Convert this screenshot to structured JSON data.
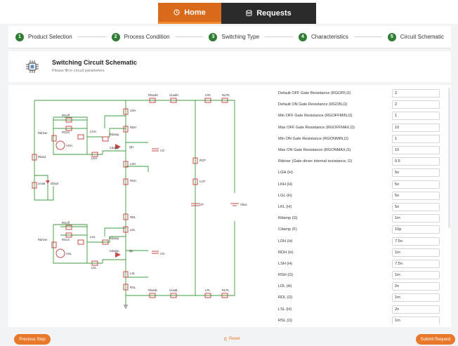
{
  "nav": {
    "home_label": "Home",
    "requests_label": "Requests",
    "home_icon": "clock-icon",
    "requests_icon": "database-icon"
  },
  "steps": [
    {
      "num": "1",
      "label": "Product Selection"
    },
    {
      "num": "2",
      "label": "Process Condition"
    },
    {
      "num": "3",
      "label": "Switching Type"
    },
    {
      "num": "4",
      "label": "Characteristics"
    },
    {
      "num": "5",
      "label": "Circuit Schematic"
    }
  ],
  "header": {
    "title": "Switching Circuit Schematic",
    "subtitle": "Please fill in circuit parameters"
  },
  "schematic": {
    "labels": {
      "ldh": "LDH",
      "rdh": "RDH",
      "lsh": "LSH",
      "rsh": "RSH",
      "rgoff_top": "RGoff",
      "rgon_top": "RGon",
      "lgh": "LGH",
      "rdriver": "Rdriver",
      "vgh": "VGH",
      "rdamp_top": "Rdamp",
      "cdamp_top": "Cdamp",
      "lkh": "LKH",
      "qh": "QH",
      "co_top": "CO",
      "rload": "Rload",
      "lload": "Lload",
      "dload": "Dload",
      "rloadh": "RloadH",
      "lloadh": "LloadH",
      "lpk": "LPK",
      "rlpk": "RLPK",
      "rcp": "RCP",
      "lcp": "LCP",
      "cp": "CP",
      "vbus": "Vbus",
      "rdl": "RDL",
      "ldl": "LDL",
      "rgoff_bot": "RGoff",
      "rgon_bot": "RGon",
      "lgl": "LGL",
      "rdriver_bot": "Rdriver",
      "vgl": "VGL",
      "rdamp_bot": "Rdamp",
      "cdamp_bot": "Cdamp",
      "lkl": "LKL",
      "ql": "QL",
      "co_bot": "CO",
      "lsl": "LSL",
      "rsl": "RSL",
      "rloadl": "RloadL",
      "lloadl": "LloadL",
      "lpl": "LPL",
      "rlpl": "RLPL"
    }
  },
  "params": [
    {
      "label": "Default OFF Gate Resistance (RGOFF,Ω)",
      "value": "2"
    },
    {
      "label": "Default ON Gate Resistance (RGON,Ω)",
      "value": "2"
    },
    {
      "label": "Min OFF Gate Resistance (RGOFFMIN,Ω)",
      "value": "1"
    },
    {
      "label": "Max OFF Gate Resistance (RGOFFMAX,Ω)",
      "value": "10"
    },
    {
      "label": "Min ON Gate Resistance (RGONMIN,Ω)",
      "value": "1"
    },
    {
      "label": "Max ON Gate Resistance (RGONMAX,Ω)",
      "value": "10"
    },
    {
      "label": "Rdriver (Gate driver internal resistance, Ω)",
      "value": "0.5"
    },
    {
      "label": "LGH (H)",
      "value": "5n"
    },
    {
      "label": "LKH (H)",
      "value": "5n"
    },
    {
      "label": "LGL (H)",
      "value": "5n"
    },
    {
      "label": "LKL (H)",
      "value": "5n"
    },
    {
      "label": "Rdamp (Ω)",
      "value": "1m"
    },
    {
      "label": "Cdamp (F)",
      "value": "10p"
    },
    {
      "label": "LDH (H)",
      "value": "7.5n"
    },
    {
      "label": "RDH (H)",
      "value": "1m"
    },
    {
      "label": "LSH (H)",
      "value": "7.5n"
    },
    {
      "label": "RSH (Ω)",
      "value": "1m"
    },
    {
      "label": "LDL (H)",
      "value": "2n"
    },
    {
      "label": "RDL (Ω)",
      "value": "1m"
    },
    {
      "label": "LSL (H)",
      "value": "2n"
    },
    {
      "label": "RSL (Ω)",
      "value": "1m"
    }
  ],
  "footer": {
    "prev_label": "Previous Step",
    "reset_label": "Reset",
    "submit_label": "Submit Request"
  },
  "colors": {
    "accent": "#e8782a",
    "nav_active": "#d96a1c",
    "nav_bg": "#2b2b2b",
    "step_done": "#2f7d32",
    "wire": "#3d9a3d",
    "component": "#c94a4a"
  }
}
